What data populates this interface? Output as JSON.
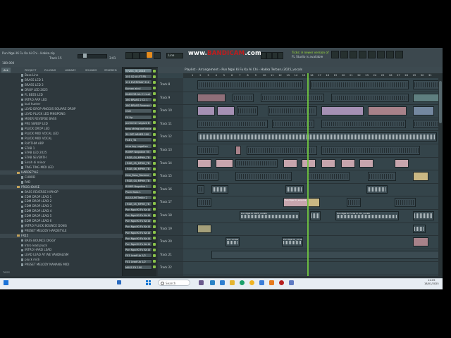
{
  "recorder": {
    "watermark_prefix": "www.",
    "watermark_brand": "BANDICAM",
    "watermark_suffix": ".com"
  },
  "topbar": {
    "file_title": "Pun Ngai Ki Fu Ka Ai Chi - Hakka.zip",
    "sub_title": "Track 15",
    "tempo": "180.000",
    "pattern": "Line",
    "pattern_num": "1",
    "hint_line1": "Ticks: A newer version of",
    "hint_line2": "FL Studio is available",
    "counter": "3:01"
  },
  "browser": {
    "header": "Browser",
    "tabs": [
      "ALL",
      "PROJECT",
      "PLUGINS",
      "LIBRARY",
      "SOUNDS",
      "STARRED"
    ],
    "items": [
      {
        "label": "Bass Line",
        "kind": "file"
      },
      {
        "label": "BRASS LED 1",
        "kind": "file"
      },
      {
        "label": "BRASS LED 2",
        "kind": "file"
      },
      {
        "label": "DROP LED 2025",
        "kind": "file"
      },
      {
        "label": "FL BEES LED",
        "kind": "file"
      },
      {
        "label": "INTRO ARP LED",
        "kind": "file"
      },
      {
        "label": "kud hunter",
        "kind": "file"
      },
      {
        "label": "LEAD DROP ANGGIS SQUARE DROP",
        "kind": "file"
      },
      {
        "label": "LEAD PLUCK LED PINGPONG",
        "kind": "file"
      },
      {
        "label": "MIXER REVERSE BASS",
        "kind": "file"
      },
      {
        "label": "PRE SWEEP LED",
        "kind": "file"
      },
      {
        "label": "PLUCK DROP LED",
        "kind": "file"
      },
      {
        "label": "PLUCK MIDI VOCAL LED",
        "kind": "file"
      },
      {
        "label": "PLUCK MIDI VOCAL",
        "kind": "file"
      },
      {
        "label": "RHYTHM ARP",
        "kind": "file"
      },
      {
        "label": "STAB 1",
        "kind": "file"
      },
      {
        "label": "STAB LED 2025",
        "kind": "file"
      },
      {
        "label": "STAB SEVENTH",
        "kind": "file"
      },
      {
        "label": "Sirsih di minor",
        "kind": "file"
      },
      {
        "label": "TING TING MIDI LED",
        "kind": "file"
      },
      {
        "label": "HARDSTYLE",
        "kind": "folder"
      },
      {
        "label": "CHORD",
        "kind": "file"
      },
      {
        "label": "PAD",
        "kind": "file"
      },
      {
        "label": "PROGHOUSE",
        "kind": "folder"
      },
      {
        "label": "BASS REVERSE HIPHOP",
        "kind": "file"
      },
      {
        "label": "EDM DROP LEAD 1",
        "kind": "file"
      },
      {
        "label": "EDM DROP LEAD 2",
        "kind": "file"
      },
      {
        "label": "EDM DROP LEAD 3",
        "kind": "file"
      },
      {
        "label": "EDM DROP LEAD 4",
        "kind": "file"
      },
      {
        "label": "EDM DROP LEAD 5",
        "kind": "file"
      },
      {
        "label": "EDM DROP LEAD 6",
        "kind": "file"
      },
      {
        "label": "INTRO PLUCK BOUNCE DONG",
        "kind": "file"
      },
      {
        "label": "PRESET MELODY HARDSTYLE",
        "kind": "file"
      },
      {
        "label": "FX15",
        "kind": "folder"
      },
      {
        "label": "BASS BOUNCE DIGGY",
        "kind": "file"
      },
      {
        "label": "Intro lead pluck",
        "kind": "file"
      },
      {
        "label": "INTRO HARD LEAD",
        "kind": "file"
      },
      {
        "label": "LEAD LEAD AT WE VANDALISM",
        "kind": "file"
      },
      {
        "label": "pluck midi",
        "kind": "file"
      },
      {
        "label": "PRESET MELODY NANANG MIDI",
        "kind": "file"
      }
    ],
    "footer": "TAGS"
  },
  "channels": [
    "TJ VOC_3t_2018",
    "101 Q2 A LFT FR",
    "111 EVERYDAY 314",
    "Kumon aicul",
    "KAKICOB AA C1 Lud",
    "180 BRASS 2 C1 1",
    "180 BRASS Reverse Bar",
    "Chill",
    "FX Up",
    "purimmer segave B",
    "bass string pad vocal",
    "30 OPP ARKER 200",
    "Fx#1_TA",
    "intro key negative",
    "ROMPI Negative TB",
    "J RGB_04_MPHH_TB",
    "J RGB_05_MPHH_TB",
    "J RGB_06_MPHH_TB",
    "Desi_Bass_Reverse",
    "J RGB_04_MPHH_TB",
    "ROMPI Negative 1",
    "Pluck Bass 1",
    "ALLILIUM Treble 2",
    "J RGB_05_MPHH_TB",
    "Pun Ngai Ki Fu Ka Ai",
    "Pun Ngai Ki Fu Ka Ai",
    "Pun Ngai Ki Fu Ka Ai",
    "Pun Ngai Ki Fu Ka Ai",
    "Pun Ngai Ki Fu Ka Ai",
    "Pun Ngai Ki Fu Ka Ai",
    "Pun Ngai Ki Fu Ka Ai",
    "Pun Ngai Ki Fu Ka Ai",
    "FX1 Lead Up 1/2",
    "FX1 Lead Up 1/2",
    "MASS FX 100"
  ],
  "playlist": {
    "title": "Playlist - Arrangement › Pun Ngai Ki Fu Ka Ai Chi - Hakka Terbaru 2025_vocals",
    "ruler": [
      "1",
      "2",
      "3",
      "4",
      "5",
      "6",
      "7",
      "8",
      "9",
      "10",
      "11",
      "12",
      "13",
      "14",
      "15",
      "16",
      "17",
      "18",
      "19",
      "20",
      "21",
      "22",
      "23",
      "24",
      "25",
      "26",
      "27",
      "28",
      "29",
      "30",
      "31"
    ],
    "tracks": [
      "Track 8",
      "Track 9",
      "Track 10",
      "Track 11",
      "Track 12",
      "Track 13",
      "Track 14",
      "Track 15",
      "Track 16",
      "Track 17",
      "Track 18",
      "Track 19",
      "Track 20",
      "Track 21",
      "Track 22"
    ],
    "clip_labels": {
      "drop": "Pun Ngai Ki_sequoia",
      "vocals_a": "Pun Ngai Ki 2025_vocals",
      "vocals_b": "Pun Ngai Ki Fu Ka Ai Chi_vocals",
      "vocals_c": "Pun Ngai Ki Fu Ka Ai Chi_vocals",
      "vocal_short": "Pun vocals",
      "vocal_tail": "Pun Ngai Ki_vocals"
    }
  },
  "taskbar": {
    "search": "Search",
    "time": "12:05",
    "date": "18/01/2025"
  }
}
